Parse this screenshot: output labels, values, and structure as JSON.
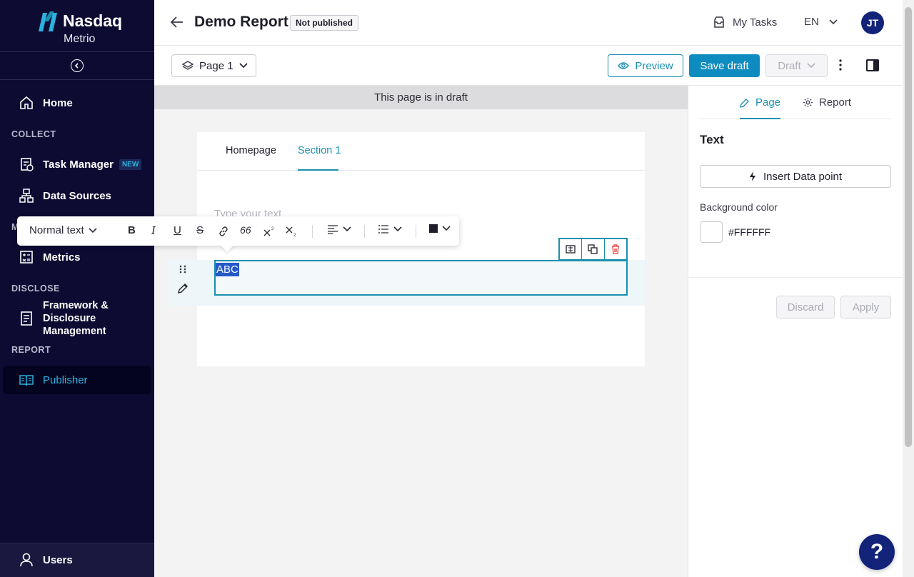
{
  "sidebar": {
    "brand": "Nasdaq",
    "product": "Metrio",
    "items": {
      "home": "Home",
      "task_manager": "Task Manager",
      "task_manager_badge": "NEW",
      "data_sources": "Data Sources",
      "metrics": "Metrics",
      "framework": "Framework & Disclosure Management",
      "publisher": "Publisher",
      "users": "Users"
    },
    "sections": {
      "collect": "COLLECT",
      "measure": "M",
      "disclose": "DISCLOSE",
      "report": "REPORT"
    }
  },
  "header": {
    "title": "Demo Report",
    "status": "Not published",
    "my_tasks": "My Tasks",
    "language": "EN",
    "avatar_initials": "JT"
  },
  "toolbar": {
    "page_select": "Page 1",
    "preview": "Preview",
    "save_draft": "Save draft",
    "draft": "Draft"
  },
  "canvas": {
    "banner": "This page is in draft",
    "tabs": [
      "Homepage",
      "Section 1"
    ],
    "active_tab": "Section 1",
    "placeholder": "Type your text",
    "selected_text": "ABC"
  },
  "format_bar": {
    "style": "Normal text",
    "quote_glyph": "66"
  },
  "right_panel": {
    "tabs": [
      "Page",
      "Report"
    ],
    "heading": "Text",
    "insert_button": "Insert Data point",
    "background_label": "Background color",
    "background_value": "#FFFFFF",
    "discard": "Discard",
    "apply": "Apply"
  },
  "help_glyph": "?",
  "colors": {
    "sidebar_bg": "#0e0b33",
    "accent": "#1a8fb0",
    "primary_button": "#0f8cbf",
    "avatar_bg": "#13237a",
    "selection": "#2459c9"
  }
}
